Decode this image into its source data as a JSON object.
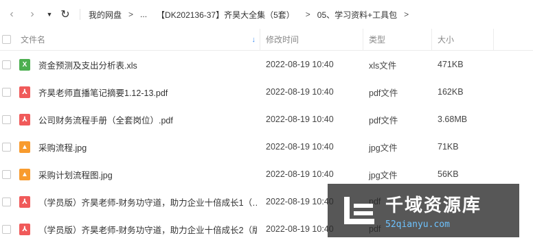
{
  "nav": {
    "back_glyph": "‹",
    "forward_glyph": "›",
    "dropdown_glyph": "▼",
    "refresh_glyph": "↻"
  },
  "breadcrumb": [
    {
      "label": "我的网盘"
    },
    {
      "label": "..."
    },
    {
      "label": "【DK202136-37】齐昊大全集（5套）"
    },
    {
      "label": "05、学习资料+工具包"
    }
  ],
  "breadcrumb_arrow": ">",
  "columns": {
    "name": "文件名",
    "modified": "修改时间",
    "type": "类型",
    "size": "大小",
    "sort_indicator": "↓"
  },
  "files": [
    {
      "icon": "xls-file-icon",
      "icon_glyph": "X",
      "kind": "xls",
      "name": "资金预测及支出分析表.xls",
      "modified": "2022-08-19 10:40",
      "type": "xls文件",
      "size": "471KB"
    },
    {
      "icon": "pdf-file-icon",
      "icon_glyph": "⅄",
      "kind": "pdf",
      "name": "齐昊老师直播笔记摘要1.12-13.pdf",
      "modified": "2022-08-19 10:40",
      "type": "pdf文件",
      "size": "162KB"
    },
    {
      "icon": "pdf-file-icon",
      "icon_glyph": "⅄",
      "kind": "pdf",
      "name": "公司财务流程手册（全套岗位）.pdf",
      "modified": "2022-08-19 10:40",
      "type": "pdf文件",
      "size": "3.68MB"
    },
    {
      "icon": "jpg-file-icon",
      "icon_glyph": "▲",
      "kind": "jpg",
      "name": "采购流程.jpg",
      "modified": "2022-08-19 10:40",
      "type": "jpg文件",
      "size": "71KB"
    },
    {
      "icon": "jpg-file-icon",
      "icon_glyph": "▲",
      "kind": "jpg",
      "name": "采购计划流程图.jpg",
      "modified": "2022-08-19 10:40",
      "type": "jpg文件",
      "size": "56KB"
    },
    {
      "icon": "pdf-file-icon",
      "icon_glyph": "⅄",
      "kind": "pdf",
      "name": "（学员版）齐昊老师-财务功守道，助力企业十倍成长1（…",
      "modified": "2022-08-19 10:40",
      "type": "pdf",
      "size": ""
    },
    {
      "icon": "pdf-file-icon",
      "icon_glyph": "⅄",
      "kind": "pdf",
      "name": "（学员版）齐昊老师-财务功守道，助力企业十倍成长2（版…",
      "modified": "2022-08-19 10:40",
      "type": "pdf",
      "size": ""
    }
  ],
  "watermark": {
    "title": "千域资源库",
    "url": "52qianyu.com"
  }
}
